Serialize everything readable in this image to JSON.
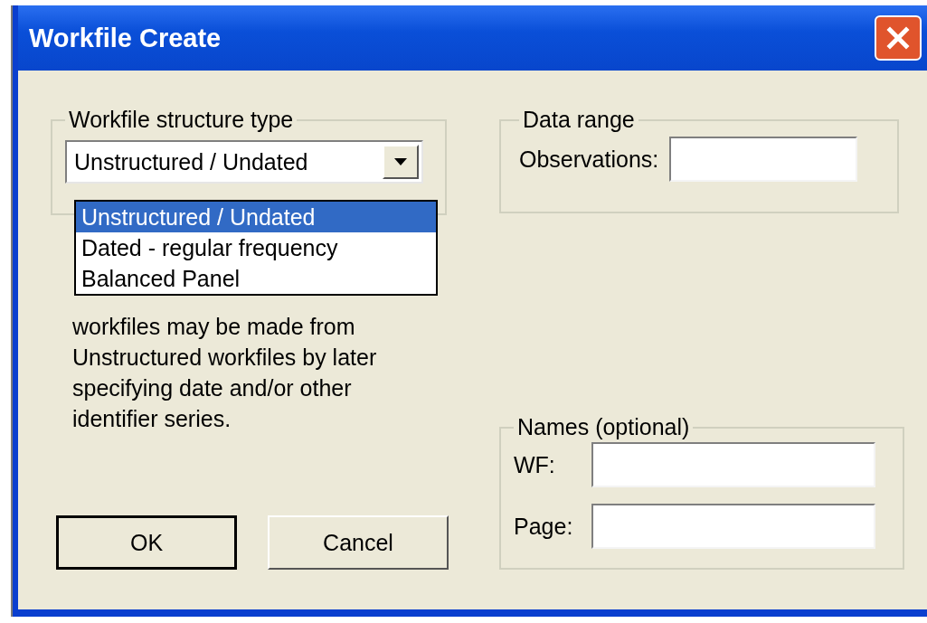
{
  "window": {
    "title": "Workfile Create"
  },
  "structure_group": {
    "legend": "Workfile structure type",
    "combo": {
      "value": "Unstructured / Undated",
      "open": true
    },
    "options": [
      {
        "label": "Unstructured / Undated",
        "selected": true
      },
      {
        "label": "Dated - regular frequency",
        "selected": false
      },
      {
        "label": "Balanced Panel",
        "selected": false
      }
    ],
    "description": "workfiles may be made from Unstructured workfiles by later specifying date and/or other identifier series."
  },
  "buttons": [
    {
      "label": "OK",
      "default": true
    },
    {
      "label": "Cancel",
      "default": false
    }
  ],
  "data_range": {
    "legend": "Data range",
    "fields": [
      {
        "label": "Observations:"
      }
    ]
  },
  "names": {
    "legend": "Names (optional)",
    "fields": [
      {
        "label": "WF:"
      },
      {
        "label": "Page:"
      }
    ]
  }
}
